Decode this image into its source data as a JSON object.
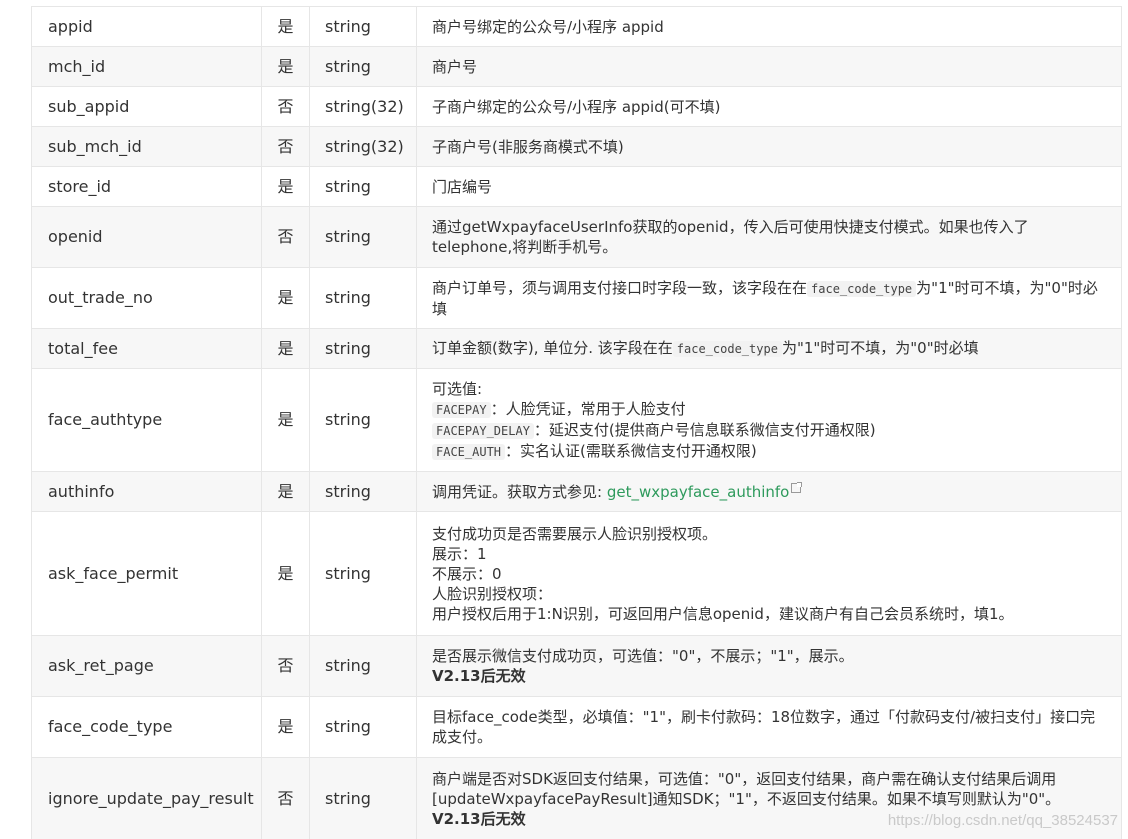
{
  "table": {
    "rows": [
      {
        "name": "appid",
        "required": "是",
        "type": "string",
        "desc": [
          "商户号绑定的公众号/小程序 appid"
        ]
      },
      {
        "name": "mch_id",
        "required": "是",
        "type": "string",
        "desc": [
          "商户号"
        ]
      },
      {
        "name": "sub_appid",
        "required": "否",
        "type": "string(32)",
        "desc": [
          "子商户绑定的公众号/小程序 appid(可不填)"
        ]
      },
      {
        "name": "sub_mch_id",
        "required": "否",
        "type": "string(32)",
        "desc": [
          "子商户号(非服务商模式不填)"
        ]
      },
      {
        "name": "store_id",
        "required": "是",
        "type": "string",
        "desc": [
          "门店编号"
        ]
      },
      {
        "name": "openid",
        "required": "否",
        "type": "string",
        "desc": [
          "通过getWxpayfaceUserInfo获取的openid，传入后可使用快捷支付模式。如果也传入了telephone,将判断手机号。"
        ]
      },
      {
        "name": "out_trade_no",
        "required": "是",
        "type": "string",
        "desc_pre": "商户订单号，须与调用支付接口时字段一致，该字段在在",
        "desc_code": "face_code_type",
        "desc_post": "为\"1\"时可不填，为\"0\"时必填"
      },
      {
        "name": "total_fee",
        "required": "是",
        "type": "string",
        "desc_pre": "订单金额(数字), 单位分. 该字段在在",
        "desc_code": "face_code_type",
        "desc_post": "为\"1\"时可不填，为\"0\"时必填"
      },
      {
        "name": "face_authtype",
        "required": "是",
        "type": "string",
        "desc_title": "可选值:",
        "options": [
          {
            "code": "FACEPAY",
            "text": "：人脸凭证，常用于人脸支付"
          },
          {
            "code": "FACEPAY_DELAY",
            "text": "：延迟支付(提供商户号信息联系微信支付开通权限)"
          },
          {
            "code": "FACE_AUTH",
            "text": "：实名认证(需联系微信支付开通权限)"
          }
        ]
      },
      {
        "name": "authinfo",
        "required": "是",
        "type": "string",
        "desc_pre": "调用凭证。获取方式参见: ",
        "link": "get_wxpayface_authinfo"
      },
      {
        "name": "ask_face_permit",
        "required": "是",
        "type": "string",
        "desc": [
          "支付成功页是否需要展示人脸识别授权项。",
          "展示：1",
          "不展示：0",
          "人脸识别授权项：",
          "用户授权后用于1:N识别，可返回用户信息openid，建议商户有自己会员系统时，填1。"
        ]
      },
      {
        "name": "ask_ret_page",
        "required": "否",
        "type": "string",
        "desc": [
          "是否展示微信支付成功页，可选值：\"0\"，不展示；\"1\"，展示。"
        ],
        "desc_bold": "V2.13后无效"
      },
      {
        "name": "face_code_type",
        "required": "是",
        "type": "string",
        "desc": [
          "目标face_code类型，必填值：\"1\"，刷卡付款码：18位数字，通过「付款码支付/被扫支付」接口完成支付。"
        ]
      },
      {
        "name": "ignore_update_pay_result",
        "required": "否",
        "type": "string",
        "desc": [
          "商户端是否对SDK返回支付结果，可选值：\"0\"，返回支付结果，商户需在确认支付结果后调用[updateWxpayfacePayResult]通知SDK；\"1\"，不返回支付结果。如果不填写则默认为\"0\"。"
        ],
        "desc_bold": "V2.13后无效"
      }
    ]
  },
  "watermark": "https://blog.csdn.net/qq_38524537",
  "colors": {
    "link": "#2e9a5c",
    "border": "#e6e6e6",
    "row_alt": "#f7f7f7"
  }
}
